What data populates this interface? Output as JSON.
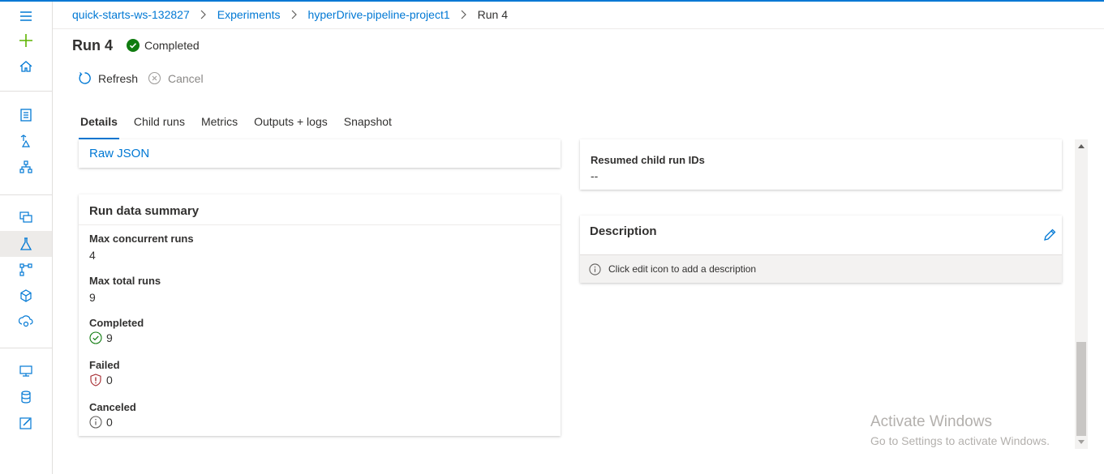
{
  "breadcrumb": [
    "quick-starts-ws-132827",
    "Experiments",
    "hyperDrive-pipeline-project1",
    "Run 4"
  ],
  "page": {
    "title": "Run 4",
    "status": "Completed"
  },
  "commands": {
    "refresh": "Refresh",
    "cancel": "Cancel"
  },
  "tabs": [
    "Details",
    "Child runs",
    "Metrics",
    "Outputs + logs",
    "Snapshot"
  ],
  "properties_card": {
    "raw_json_link": "Raw JSON"
  },
  "summary": {
    "title": "Run data summary",
    "max_concurrent_label": "Max concurrent runs",
    "max_concurrent_value": "4",
    "max_total_label": "Max total runs",
    "max_total_value": "9",
    "completed_label": "Completed",
    "completed_value": "9",
    "failed_label": "Failed",
    "failed_value": "0",
    "canceled_label": "Canceled",
    "canceled_value": "0"
  },
  "resumed": {
    "label": "Resumed child run IDs",
    "value": "--"
  },
  "description": {
    "title": "Description",
    "hint": "Click edit icon to add a description"
  },
  "watermark": {
    "line1": "Activate Windows",
    "line2": "Go to Settings to activate Windows."
  },
  "colors": {
    "accent": "#0078d4",
    "success": "#107c10",
    "error": "#a4262c",
    "sidebar_green": "#5db300"
  },
  "sidebar_icons": [
    "hamburger-icon",
    "plus-icon",
    "home-icon",
    "notebook-icon",
    "automl-icon",
    "designer-icon",
    "datasets-icon",
    "experiments-icon",
    "pipelines-icon",
    "models-icon",
    "endpoints-icon",
    "compute-icon",
    "datastores-icon",
    "labeling-icon"
  ]
}
